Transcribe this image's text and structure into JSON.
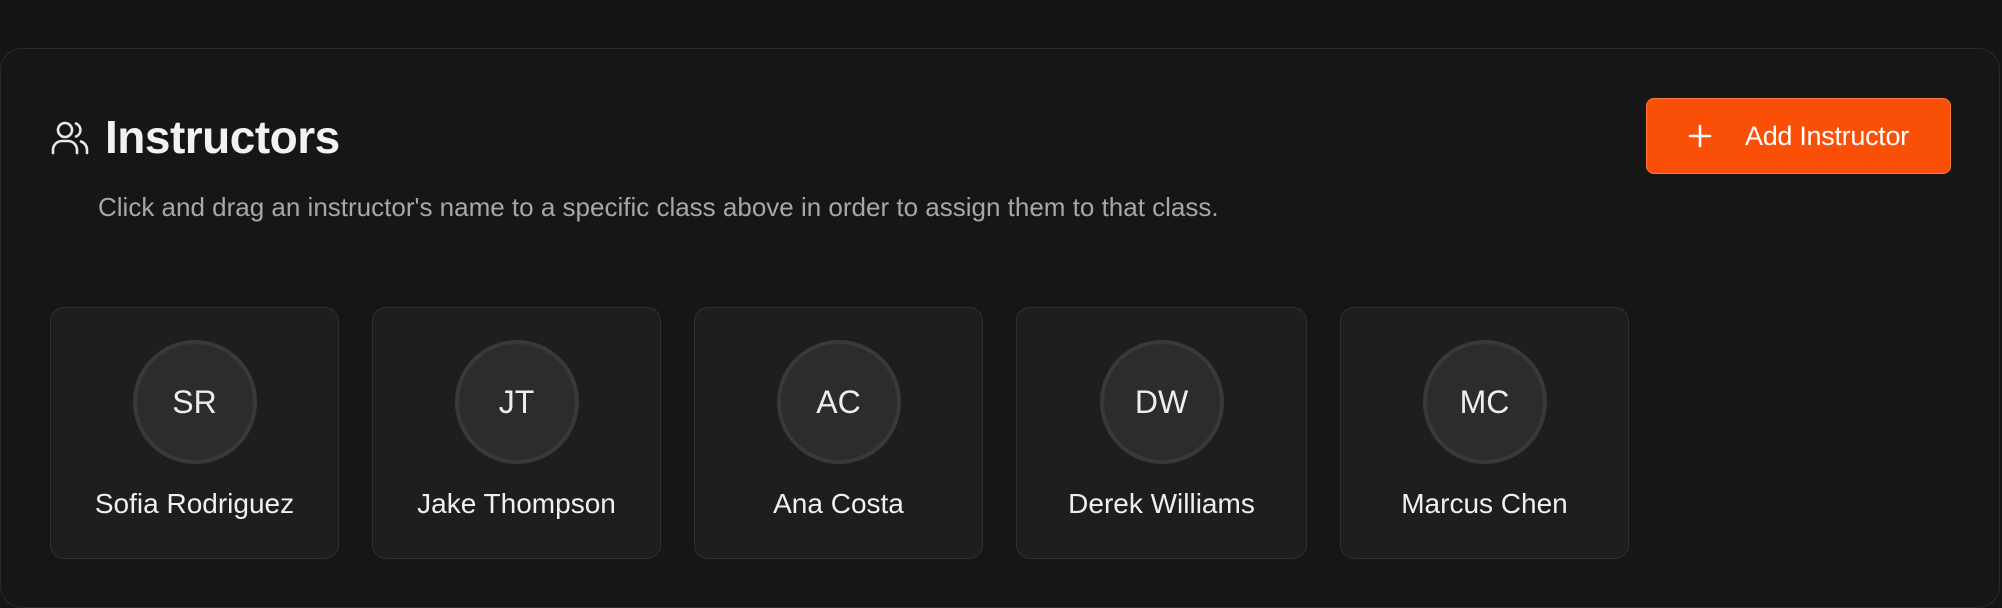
{
  "header": {
    "title": "Instructors",
    "icon": "users-icon",
    "subtitle": "Click and drag an instructor's name to a specific class above in order to assign them to that class."
  },
  "add_button": {
    "label": "Add Instructor",
    "icon": "plus-icon",
    "color": "#f94f07"
  },
  "instructors": [
    {
      "initials": "SR",
      "name": "Sofia Rodriguez"
    },
    {
      "initials": "JT",
      "name": "Jake Thompson"
    },
    {
      "initials": "AC",
      "name": "Ana Costa"
    },
    {
      "initials": "DW",
      "name": "Derek Williams"
    },
    {
      "initials": "MC",
      "name": "Marcus Chen"
    }
  ]
}
